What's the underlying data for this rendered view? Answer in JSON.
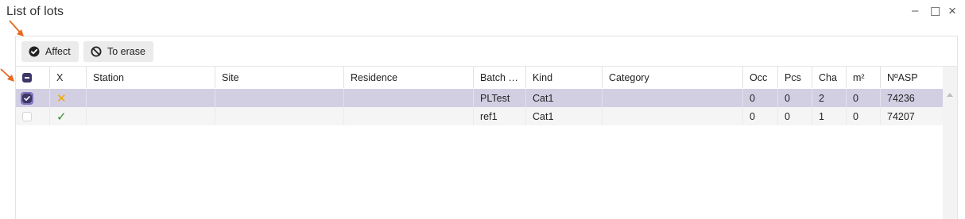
{
  "window": {
    "title": "List of lots",
    "controls": [
      "–",
      "☐",
      "×"
    ]
  },
  "toolbar": {
    "affect_label": "Affect",
    "erase_label": "To erase"
  },
  "table": {
    "columns": [
      "",
      "X",
      "Station",
      "Site",
      "Residence",
      "Batch …",
      "Kind",
      "Category",
      "Occ",
      "Pcs",
      "Cha",
      "m²",
      "NºASP"
    ],
    "rows": [
      {
        "selected": true,
        "status": "✕",
        "status_color": "#f0a500",
        "station": "",
        "site": "",
        "residence": "",
        "batch": "PLTest",
        "kind": "Cat1",
        "category": "",
        "occ": "0",
        "pcs": "0",
        "cha": "2",
        "m2": "0",
        "nasp": "74236"
      },
      {
        "selected": false,
        "status": "✓",
        "status_color": "#2e8b2e",
        "station": "",
        "site": "",
        "residence": "",
        "batch": "ref1",
        "kind": "Cat1",
        "category": "",
        "occ": "0",
        "pcs": "0",
        "cha": "1",
        "m2": "0",
        "nasp": "74207"
      }
    ]
  },
  "colors": {
    "accent": "#3c3768",
    "selected_row": "#d2cfe3",
    "annotation_arrow": "#e8681e"
  }
}
